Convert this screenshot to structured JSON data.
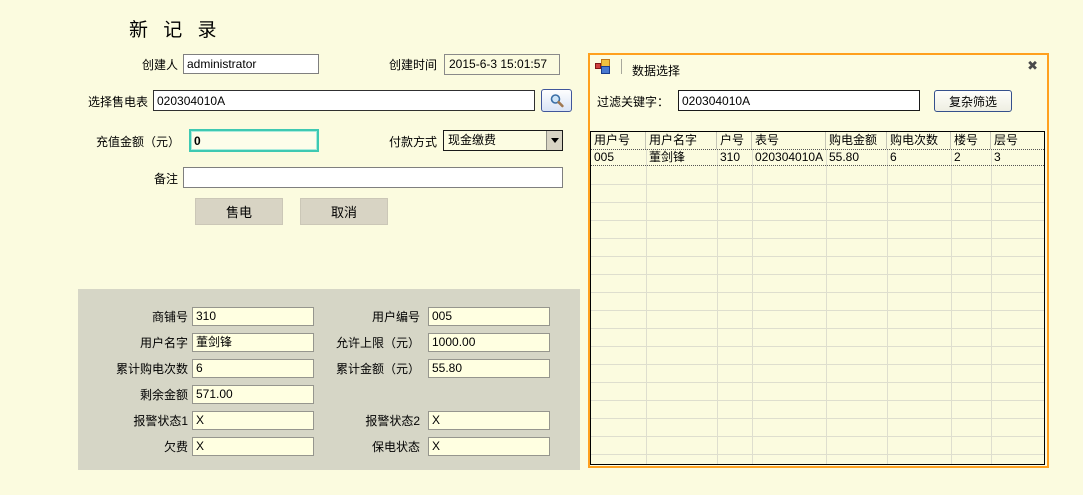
{
  "colors": {
    "page_bg": "#FBFBDF",
    "panel_gray": "#D6D6C6",
    "field_yellow": "#FFFFE1",
    "accent_orange": "#FFA01E",
    "focus_teal": "#3EC9B2"
  },
  "form": {
    "title": "新 记 录",
    "creator_label": "创建人",
    "creator_value": "administrator",
    "created_label": "创建时间",
    "created_value": "2015-6-3 15:01:57",
    "meter_label": "选择售电表",
    "meter_value": "020304010A",
    "amount_label": "充值金额（元）",
    "amount_value": "0",
    "payment_label": "付款方式",
    "payment_value": "现金缴费",
    "remark_label": "备注",
    "remark_value": "",
    "sell_button": "售电",
    "cancel_button": "取消"
  },
  "detail": {
    "fields": [
      {
        "label": "商铺号",
        "value": "310"
      },
      {
        "label": "用户编号",
        "value": "005"
      },
      {
        "label": "用户名字",
        "value": "董剑锋"
      },
      {
        "label": "允许上限（元）",
        "value": "1000.00"
      },
      {
        "label": "累计购电次数",
        "value": "6"
      },
      {
        "label": "累计金额（元）",
        "value": "55.80"
      },
      {
        "label": "剩余金额",
        "value": "571.00"
      },
      {
        "label": "报警状态1",
        "value": "X"
      },
      {
        "label": "报警状态2",
        "value": "X"
      },
      {
        "label": "欠费",
        "value": "X"
      },
      {
        "label": "保电状态",
        "value": "X"
      }
    ]
  },
  "dialog": {
    "title": "数据选择",
    "close_icon": "✖",
    "filter_label": "过滤关键字：",
    "filter_value": "020304010A",
    "filter_button": "复杂筛选",
    "table": {
      "headers": [
        "用户号",
        "用户名字",
        "户号",
        "表号",
        "购电金额",
        "购电次数",
        "楼号",
        "层号"
      ],
      "rows": [
        [
          "005",
          "董剑锋",
          "310",
          "020304010A",
          "55.80",
          "6",
          "2",
          "3"
        ]
      ]
    }
  }
}
